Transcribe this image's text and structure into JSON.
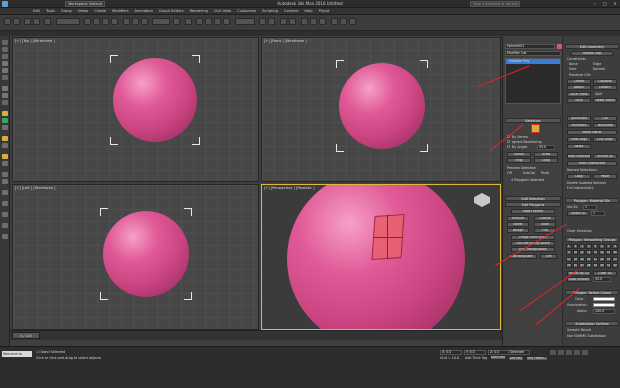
{
  "window": {
    "title": "Autodesk 3ds Max 2016    Untitled",
    "workspace": "Workspace: Default",
    "search_placeholder": "Type a keyword or phrase",
    "minimize": "–",
    "maximize": "□",
    "close": "✕"
  },
  "menu": [
    "Edit",
    "Tools",
    "Group",
    "Views",
    "Create",
    "Modifiers",
    "Animation",
    "Graph Editors",
    "Rendering",
    "Civil View",
    "Customize",
    "Scripting",
    "Content",
    "Help",
    "PhysX"
  ],
  "viewports": {
    "top": "[+] [Top ] [Wireframe ]",
    "front": "[+] [Front ] [Wireframe ]",
    "left": "[+] [Left ] [Wireframe ]",
    "perspective": "[+] [Perspective ] [Realistic ]"
  },
  "command_panel": {
    "object_name": "Sphere001",
    "modifier_list": "Modifier List",
    "stack_item": "Editable Poly",
    "selection_header": "Selection",
    "by_vertex": "By Vertex",
    "ignore_backfacing": "Ignore Backfacing",
    "by_angle": "By Angle:",
    "angle_val": "45.0",
    "shrink": "Shrink",
    "grow": "Grow",
    "ring": "Ring",
    "loop": "Loop",
    "preview_selection": "Preview Selection",
    "off": "Off",
    "subobj": "SubObj",
    "multi": "Multi",
    "selected_count": "4 Polygons Selected",
    "soft_selection": "Soft Selection",
    "edit_polygons": "Edit Polygons",
    "insert_vertex": "Insert Vertex",
    "extrude": "Extrude",
    "outline": "Outline",
    "bevel": "Bevel",
    "inset": "Inset",
    "bridge": "Bridge",
    "flip": "Flip",
    "hinge": "Hinge From Edge",
    "extrude_spline": "Extrude Along Spline",
    "edit_tri": "Edit Triangulation",
    "retriangulate": "Retriangulate",
    "turn": "Turn"
  },
  "right_panel": {
    "edit_geometry": "Edit Geometry",
    "repeat_last": "Repeat Last",
    "constraints": "Constraints",
    "none": "None",
    "edge": "Edge",
    "face": "Face",
    "normal": "Normal",
    "preserve_uvs": "Preserve UVs",
    "create": "Create",
    "collapse": "Collapse",
    "attach": "Attach",
    "detach": "Detach",
    "slice_plane": "Slice Plane",
    "split": "Split",
    "slice": "Slice",
    "reset_plane": "Reset Plane",
    "quickslice": "QuickSlice",
    "cut": "Cut",
    "meshsmooth": "MSmooth",
    "tessellate": "Tessellate",
    "make_planar": "Make Planar",
    "view_align": "View Align",
    "grid_align": "Grid Align",
    "relax": "Relax",
    "hide_selected": "Hide Selected",
    "unhide_all": "Unhide All",
    "hide_unselected": "Hide Unselected",
    "named_selections": "Named Selections:",
    "copy": "Copy",
    "paste": "Paste",
    "delete_isolated": "Delete Isolated Vertices",
    "full_interactivity": "Full Interactivity",
    "material_ids": "Polygon: Material IDs",
    "set_id": "Set ID:",
    "set_id_val": "1",
    "select_id": "Select ID",
    "select_id_val": "1",
    "clear_selection": "Clear Selection",
    "smoothing_groups": "Polygon: Smoothing Groups",
    "sg_numbers": [
      "1",
      "2",
      "3",
      "4",
      "5",
      "6",
      "7",
      "8",
      "9",
      "10",
      "11",
      "12",
      "13",
      "14",
      "15",
      "16",
      "17",
      "18",
      "19",
      "20",
      "21",
      "22",
      "23",
      "24",
      "25",
      "26",
      "27",
      "28",
      "29",
      "30",
      "31",
      "32"
    ],
    "select_by_sg": "Select By SG",
    "clear_all": "Clear All",
    "auto_smooth": "Auto Smooth",
    "auto_smooth_val": "45.0",
    "vertex_colors": "Polygon: Vertex Colors",
    "color": "Color:",
    "illumination": "Illumination:",
    "alpha": "Alpha:",
    "alpha_val": "100.0",
    "subdivision_surface": "Subdivision Surface",
    "smooth_result": "Smooth Result",
    "use_nurms": "Use NURMS Subdivision"
  },
  "timeline": {
    "frame": "0 / 100"
  },
  "status": {
    "selected": "1 Object Selected",
    "prompt": "Click or click-and-drag to select objects",
    "maxscript": "Welcome to MAXScript.",
    "x": "X: 0.0",
    "y": "Y: 0.0",
    "z": "Z: 0.0",
    "grid": "Grid = 10.0",
    "auto_key": "Auto Key",
    "selected_dd": "Selected",
    "set_key": "Set Key",
    "key_filters": "Key Filters...",
    "add_time_tag": "Add Time Tag"
  },
  "colors": {
    "sphere": "#e05a97",
    "annotation": "#e8222a",
    "accent": "#3a7bd5"
  }
}
